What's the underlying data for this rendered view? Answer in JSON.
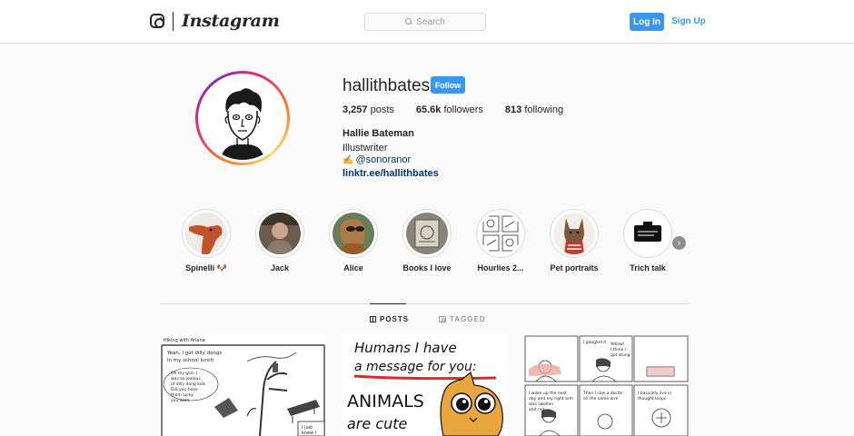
{
  "nav": {
    "wordmark": "Instagram",
    "search_placeholder": "Search",
    "login_label": "Log In",
    "signup_label": "Sign Up"
  },
  "profile": {
    "username": "hallithbates",
    "follow_label": "Follow",
    "stats": {
      "posts": "3,257",
      "posts_label": "posts",
      "followers": "65.6k",
      "followers_label": "followers",
      "following": "813",
      "following_label": "following"
    },
    "full_name": "Hallie Bateman",
    "bio": "Illustwriter",
    "mention": "@sonoranor",
    "link": "linktr.ee/hallithbates"
  },
  "highlights": [
    {
      "label": "Spinelli 🐶"
    },
    {
      "label": "Jack"
    },
    {
      "label": "Alice"
    },
    {
      "label": "Books I love"
    },
    {
      "label": "Hourlies 2..."
    },
    {
      "label": "Pet portraits"
    },
    {
      "label": "Trich talk"
    }
  ],
  "tabs": {
    "posts": "POSTS",
    "tagged": "TAGGED"
  },
  "posts": [
    {
      "lines": [
        "Hiking with Ariana",
        "Yeah, I got dilly dongs",
        "in my school lunch",
        "Oh my god, I",
        "was so jealous",
        "of dilly dong kids",
        "Did you have",
        "them lucky",
        "you were",
        "I just",
        "knew I"
      ]
    },
    {
      "lines": [
        "Humans I have",
        "a message for you:",
        "ANIMALS",
        "are cute"
      ]
    },
    {
      "lines": [
        "I woke up the next",
        "day and my right arm",
        "was swollen",
        "and red",
        "I googled it",
        "Then I saw a doctor",
        "on the same arm",
        "Yellow!",
        "I think I",
        "got stung",
        "I basically live in",
        "thought loops"
      ]
    }
  ],
  "colors": {
    "accent": "#3897f0",
    "link": "#00376b",
    "border": "#dbdbdb",
    "background": "#fafafa"
  }
}
